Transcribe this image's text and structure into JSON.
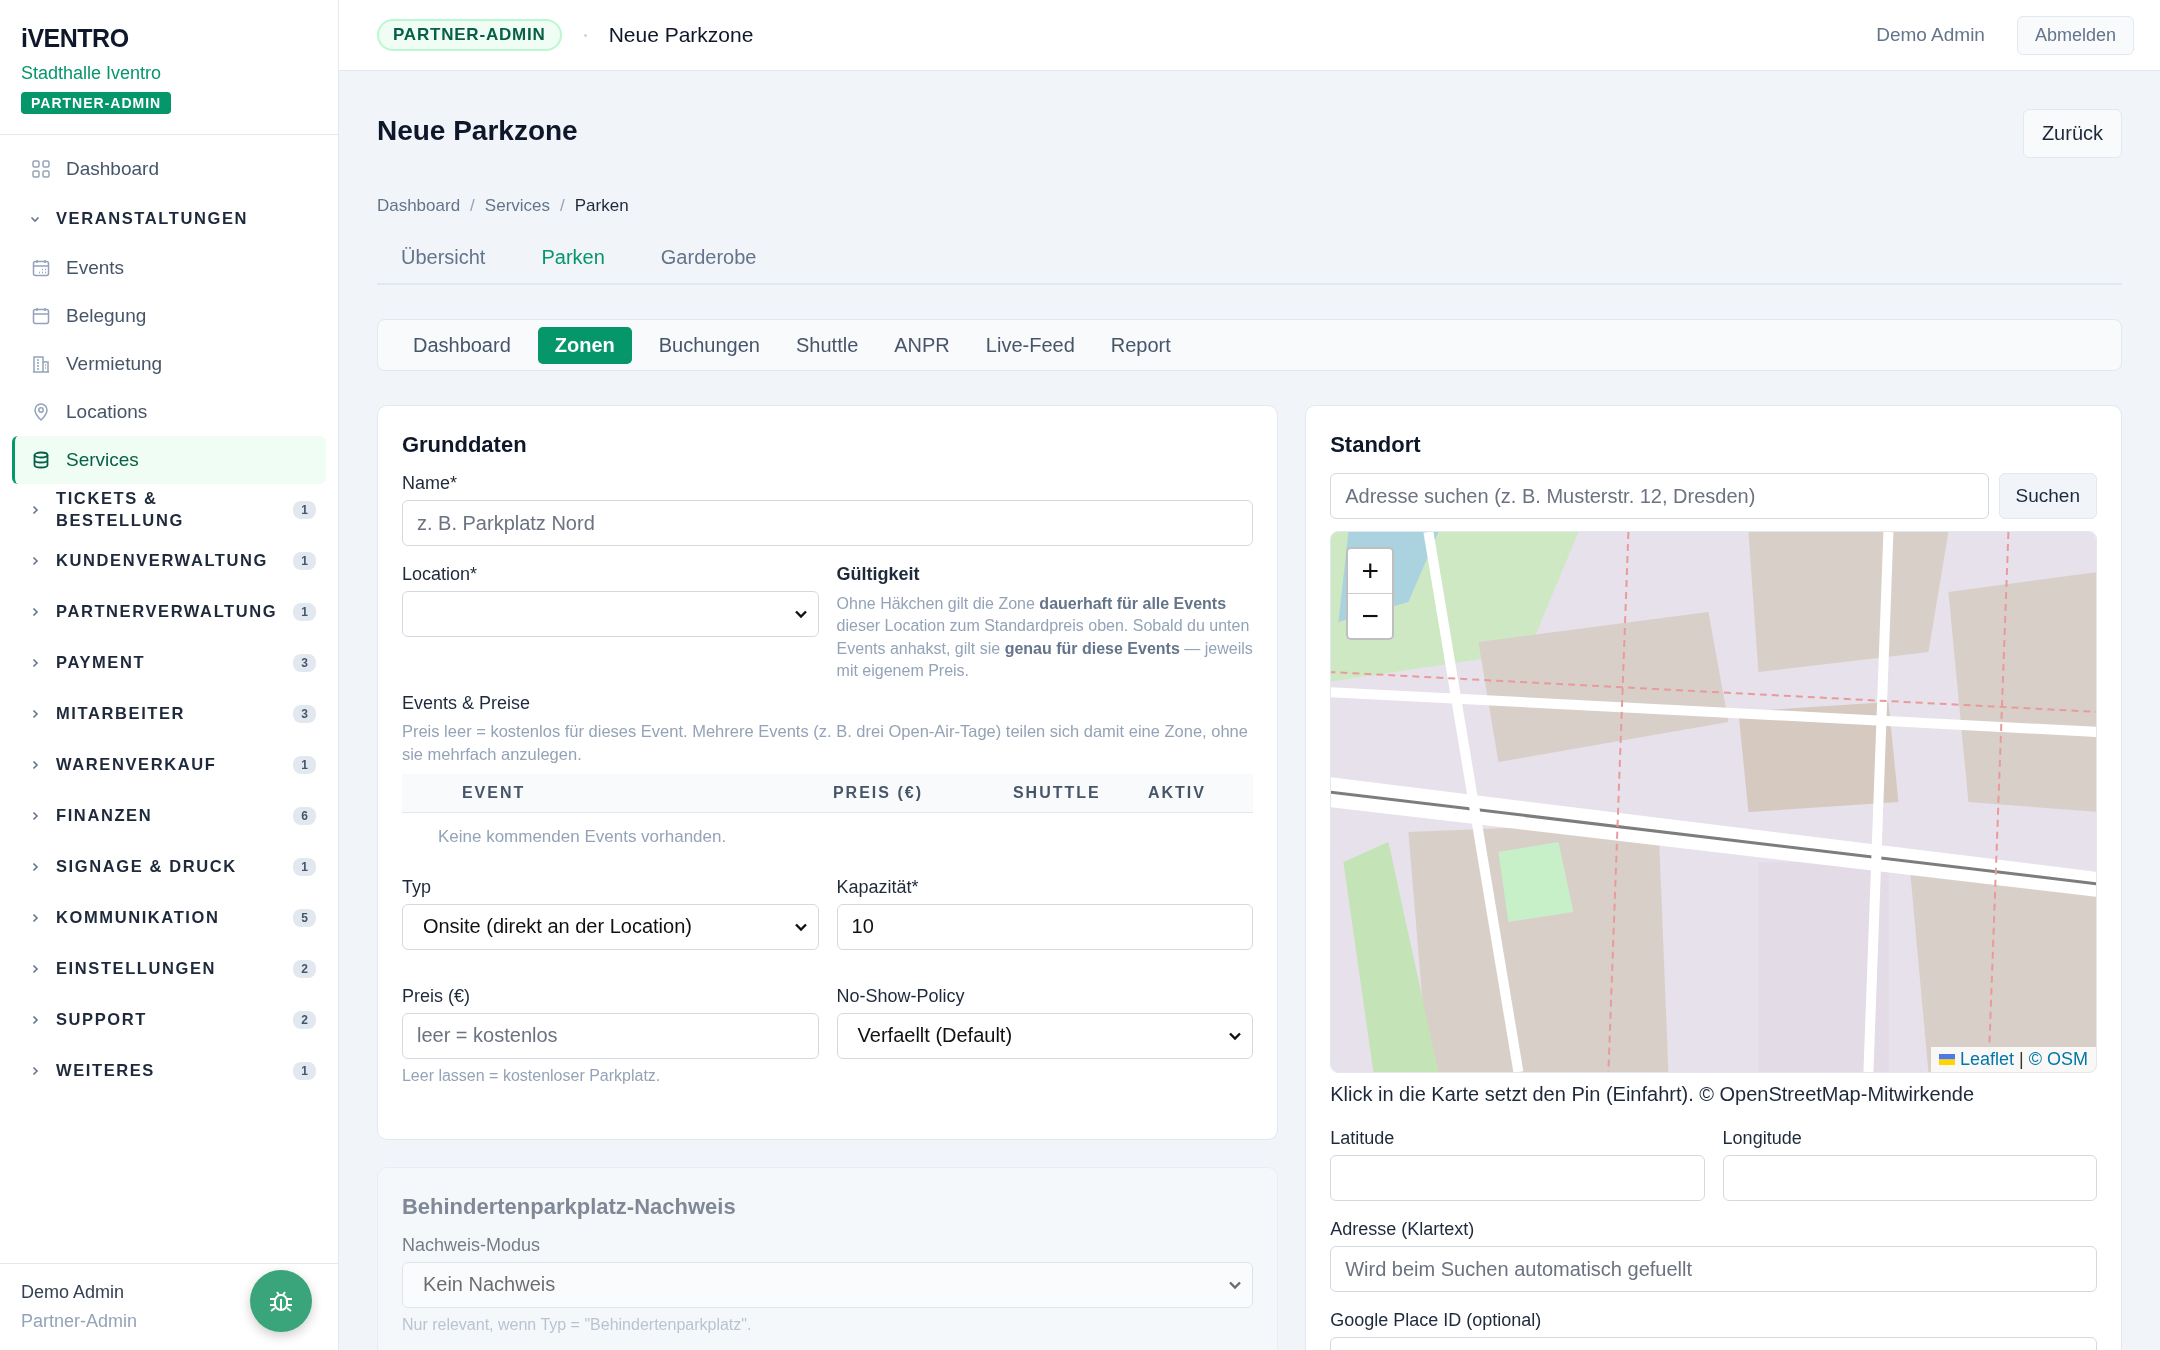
{
  "sidebar": {
    "brand": "iVENTRO",
    "venue": "Stadthalle Iventro",
    "badge": "PARTNER-ADMIN",
    "nav": [
      {
        "kind": "link",
        "label": "Dashboard",
        "selected": false
      },
      {
        "kind": "group",
        "label": "VERANSTALTUNGEN",
        "expanded": true,
        "children": [
          {
            "label": "Events",
            "selected": false
          },
          {
            "label": "Belegung",
            "selected": false
          },
          {
            "label": "Vermietung",
            "selected": false
          },
          {
            "label": "Locations",
            "selected": false
          },
          {
            "label": "Services",
            "selected": true
          }
        ]
      },
      {
        "kind": "group",
        "label": "TICKETS & BESTELLUNG",
        "expanded": false,
        "count": "1"
      },
      {
        "kind": "group",
        "label": "KUNDENVERWALTUNG",
        "expanded": false,
        "count": "1"
      },
      {
        "kind": "group",
        "label": "PARTNERVERWALTUNG",
        "expanded": false,
        "count": "1"
      },
      {
        "kind": "group",
        "label": "PAYMENT",
        "expanded": false,
        "count": "3"
      },
      {
        "kind": "group",
        "label": "MITARBEITER",
        "expanded": false,
        "count": "3"
      },
      {
        "kind": "group",
        "label": "WARENVERKAUF",
        "expanded": false,
        "count": "1"
      },
      {
        "kind": "group",
        "label": "FINANZEN",
        "expanded": false,
        "count": "6"
      },
      {
        "kind": "group",
        "label": "SIGNAGE & DRUCK",
        "expanded": false,
        "count": "1"
      },
      {
        "kind": "group",
        "label": "KOMMUNIKATION",
        "expanded": false,
        "count": "5"
      },
      {
        "kind": "group",
        "label": "EINSTELLUNGEN",
        "expanded": false,
        "count": "2"
      },
      {
        "kind": "group",
        "label": "SUPPORT",
        "expanded": false,
        "count": "2"
      },
      {
        "kind": "group",
        "label": "WEITERES",
        "expanded": false,
        "count": "1"
      }
    ],
    "user": {
      "name": "Demo Admin",
      "role": "Partner-Admin"
    }
  },
  "topbar": {
    "badge": "PARTNER-ADMIN",
    "title": "Neue Parkzone",
    "user": "Demo Admin",
    "logout": "Abmelden"
  },
  "page": {
    "title": "Neue Parkzone",
    "back": "Zurück"
  },
  "breadcrumb": [
    "Dashboard",
    "Services",
    "Parken"
  ],
  "breadcrumb_separator": "/",
  "tabs": [
    {
      "label": "Übersicht",
      "selected": false
    },
    {
      "label": "Parken",
      "selected": true
    },
    {
      "label": "Garderobe",
      "selected": false
    }
  ],
  "subtabs": [
    {
      "label": "Dashboard",
      "selected": false
    },
    {
      "label": "Zonen",
      "selected": true
    },
    {
      "label": "Buchungen",
      "selected": false
    },
    {
      "label": "Shuttle",
      "selected": false
    },
    {
      "label": "ANPR",
      "selected": false
    },
    {
      "label": "Live-Feed",
      "selected": false
    },
    {
      "label": "Report",
      "selected": false
    }
  ],
  "grunddaten": {
    "title": "Grunddaten",
    "name": {
      "label": "Name*",
      "placeholder": "z. B. Parkplatz Nord"
    },
    "location": {
      "label": "Location*"
    },
    "validity": {
      "title": "Gültigkeit",
      "text": "Ohne Häkchen gilt die Zone **dauerhaft für alle Events** dieser Location zum Standardpreis oben. Sobald du unten Events anhakst, gilt sie **genau für diese Events** — jeweils mit eigenem Preis."
    },
    "events": {
      "title": "Events & Preise",
      "hint": "Preis leer = kostenlos für dieses Event. Mehrere Events (z. B. drei Open-Air-Tage) teilen sich damit eine Zone, ohne sie mehrfach anzulegen.",
      "columns": [
        "EVENT",
        "PREIS (€)",
        "SHUTTLE",
        "AKTIV"
      ],
      "empty": "Keine kommenden Events vorhanden."
    },
    "fields": [
      {
        "kind": "select",
        "label": "Typ",
        "value": "Onsite (direkt an der Location)"
      },
      {
        "kind": "input",
        "label": "Kapazität*",
        "value": "10"
      },
      {
        "kind": "input",
        "label": "Preis (€)",
        "placeholder": "leer = kostenlos",
        "hint": "Leer lassen = kostenloser Parkplatz."
      },
      {
        "kind": "select",
        "label": "No-Show-Policy",
        "value": "Verfaellt (Default)"
      }
    ]
  },
  "nachweis": {
    "title": "Behindertenparkplatz-Nachweis",
    "disabled": true,
    "label": "Nachweis-Modus",
    "value": "Kein Nachweis",
    "hint": "Nur relevant, wenn Typ = \"Behindertenparkplatz\"."
  },
  "standort": {
    "title": "Standort",
    "search_placeholder": "Adresse suchen (z. B. Musterstr. 12, Dresden)",
    "search_button": "Suchen",
    "map": {
      "kind": "picture",
      "zoom_in": "+",
      "zoom_out": "−",
      "attribution_links": [
        "Leaflet",
        "© OSM"
      ],
      "attribution_separator": "|"
    },
    "note": "Klick in die Karte setzt den Pin (Einfahrt). © OpenStreetMap-Mitwirkende",
    "latitude": {
      "label": "Latitude"
    },
    "longitude": {
      "label": "Longitude"
    },
    "address": {
      "label": "Adresse (Klartext)",
      "placeholder": "Wird beim Suchen automatisch gefuellt"
    },
    "place_id": {
      "label": "Google Place ID (optional)"
    }
  }
}
